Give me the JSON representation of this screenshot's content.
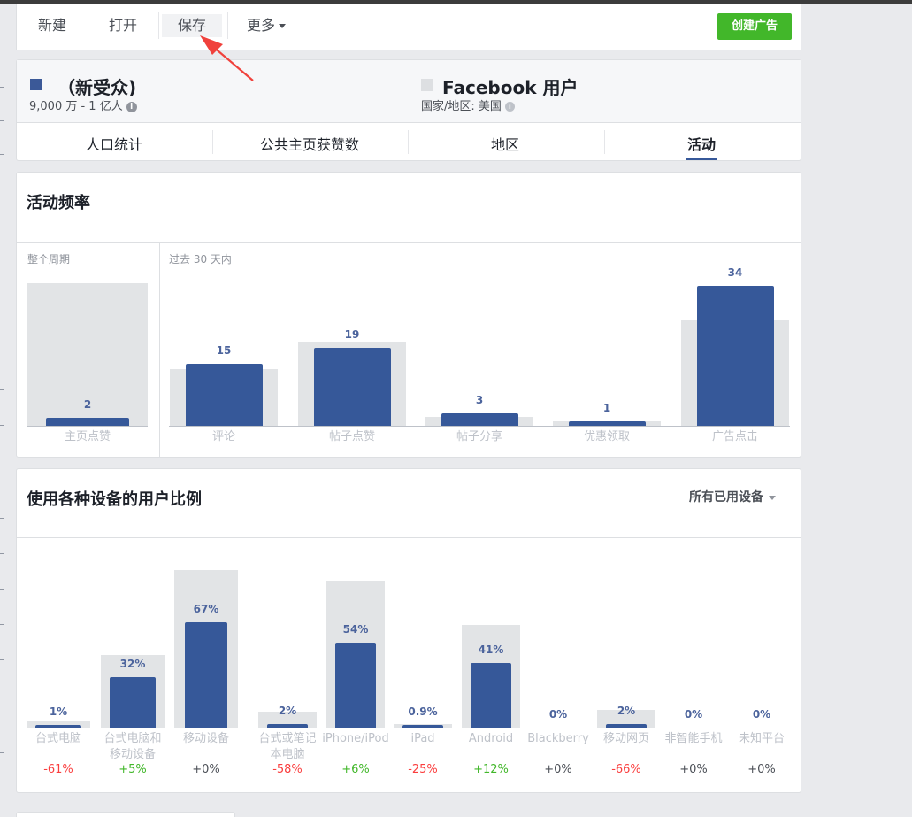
{
  "toolbar": {
    "new_label": "新建",
    "open_label": "打开",
    "save_label": "保存",
    "more_label": "更多",
    "create_ad_label": "创建广告",
    "create_ad_color": "#42b72a"
  },
  "audience": {
    "name": "（新受众)",
    "size": "9,000 万 - 1 亿人",
    "color": "#3b5998",
    "compare_name": "Facebook 用户",
    "compare_sub": "国家/地区:  美国",
    "compare_color": "#dddfe2",
    "tabs": [
      {
        "label": "人口统计",
        "active": false
      },
      {
        "label": "公共主页获赞数",
        "active": false
      },
      {
        "label": "地区",
        "active": false
      },
      {
        "label": "活动",
        "active": true
      }
    ]
  },
  "activity": {
    "title": "活动频率",
    "period_all": "整个周期",
    "period_30": "过去 30 天内"
  },
  "devices": {
    "title": "使用各种设备的用户比例",
    "dropdown_label": "所有已用设备"
  },
  "chart_data": [
    {
      "type": "bar",
      "title": "活动频率",
      "groups": [
        {
          "name": "整个周期",
          "categories": [
            "主页点赞"
          ],
          "series": [
            {
              "values": [
                2
              ],
              "color": "#365899"
            }
          ],
          "comparison_relative": [
            1.0
          ]
        },
        {
          "name": "过去 30 天内",
          "categories": [
            "评论",
            "帖子点赞",
            "帖子分享",
            "优惠领取",
            "广告点击"
          ],
          "series": [
            {
              "values": [
                15,
                19,
                3,
                1,
                34
              ],
              "color": "#365899"
            }
          ],
          "comparison_relative": [
            0.4,
            0.59,
            0.06,
            0.03,
            0.74
          ]
        }
      ]
    },
    {
      "type": "bar",
      "title": "使用各种设备的用户比例",
      "groups": [
        {
          "categories": [
            "台式电脑",
            "台式电脑和移动设备",
            "移动设备"
          ],
          "labels": [
            "1%",
            "32%",
            "67%"
          ],
          "series": [
            {
              "values": [
                1,
                32,
                67
              ],
              "color": "#365899"
            }
          ],
          "comparison_values": [
            4,
            46,
            100
          ],
          "differences": [
            "-61%",
            "+5%",
            "+0%"
          ]
        },
        {
          "categories": [
            "台式或笔记本电脑",
            "iPhone/iPod",
            "iPad",
            "Android",
            "Blackberry",
            "移动网页",
            "非智能手机",
            "未知平台"
          ],
          "labels": [
            "2%",
            "54%",
            "0.9%",
            "41%",
            "0%",
            "2%",
            "0%",
            "0%"
          ],
          "series": [
            {
              "values": [
                2,
                54,
                0.9,
                41,
                0,
                2,
                0,
                0
              ],
              "color": "#365899"
            }
          ],
          "comparison_values": [
            10,
            93,
            2,
            65,
            0,
            11,
            0,
            0
          ],
          "differences": [
            "-58%",
            "+6%",
            "-25%",
            "+12%",
            "+0%",
            "-66%",
            "+0%",
            "+0%"
          ]
        }
      ]
    }
  ],
  "colors": {
    "positive": "#42b72a",
    "negative": "#fa3e3e",
    "neutral": "#4b4f56",
    "bar": "#365899",
    "ghost_bar": "#dddfe2",
    "annotation_arrow": "#f0413c"
  }
}
